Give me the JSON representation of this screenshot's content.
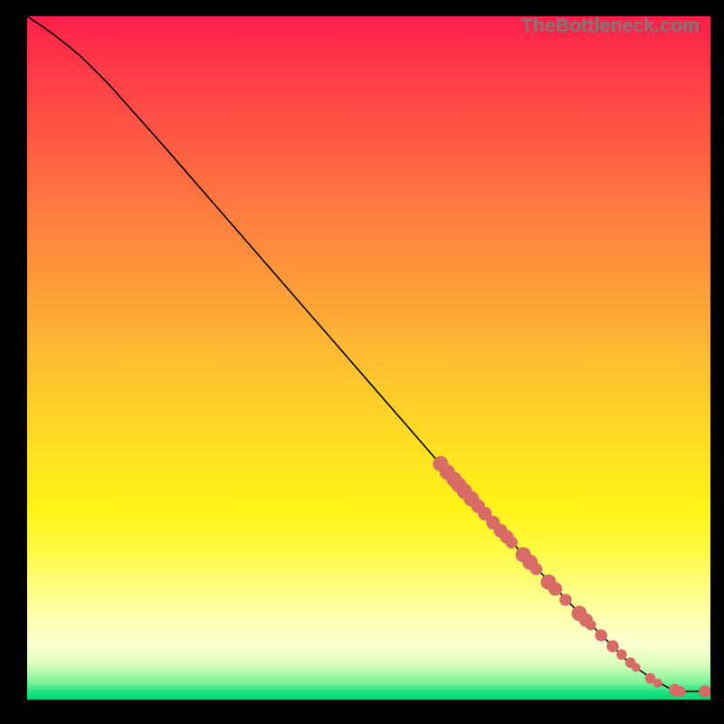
{
  "attribution": "TheBottleneck.com",
  "colors": {
    "dot": "#d96b66",
    "curve": "#000000",
    "gradient_top": "#ff1f4a",
    "gradient_bottom": "#00d977"
  },
  "chart_data": {
    "type": "line",
    "title": "",
    "xlabel": "",
    "ylabel": "",
    "xlim": [
      0,
      100
    ],
    "ylim": [
      0,
      100
    ],
    "curve": [
      {
        "x": 0,
        "y": 100
      },
      {
        "x": 4,
        "y": 97.5
      },
      {
        "x": 8,
        "y": 94
      },
      {
        "x": 12,
        "y": 90
      },
      {
        "x": 20,
        "y": 81
      },
      {
        "x": 30,
        "y": 69.5
      },
      {
        "x": 40,
        "y": 58
      },
      {
        "x": 50,
        "y": 46.5
      },
      {
        "x": 60,
        "y": 35
      },
      {
        "x": 70,
        "y": 24
      },
      {
        "x": 80,
        "y": 13.5
      },
      {
        "x": 88,
        "y": 5.5
      },
      {
        "x": 92,
        "y": 2.5
      },
      {
        "x": 95,
        "y": 1.2
      },
      {
        "x": 96,
        "y": 1.2
      },
      {
        "x": 100,
        "y": 1.2
      }
    ],
    "series": [
      {
        "name": "points",
        "marker": "circle",
        "points": [
          {
            "x": 60.5,
            "y": 34.5,
            "r": 1.2
          },
          {
            "x": 61.5,
            "y": 33.3,
            "r": 1.2
          },
          {
            "x": 62.5,
            "y": 32.2,
            "r": 1.2
          },
          {
            "x": 63.2,
            "y": 31.4,
            "r": 1.2
          },
          {
            "x": 64.0,
            "y": 30.5,
            "r": 1.2
          },
          {
            "x": 65.0,
            "y": 29.4,
            "r": 1.2
          },
          {
            "x": 66.0,
            "y": 28.3,
            "r": 1.1
          },
          {
            "x": 67.0,
            "y": 27.2,
            "r": 1.1
          },
          {
            "x": 68.2,
            "y": 25.9,
            "r": 1.1
          },
          {
            "x": 69.3,
            "y": 24.7,
            "r": 1.1
          },
          {
            "x": 70.2,
            "y": 23.8,
            "r": 1.1
          },
          {
            "x": 70.9,
            "y": 23.0,
            "r": 1.0
          },
          {
            "x": 72.6,
            "y": 21.2,
            "r": 1.2
          },
          {
            "x": 73.6,
            "y": 20.1,
            "r": 1.2
          },
          {
            "x": 74.5,
            "y": 19.1,
            "r": 1.0
          },
          {
            "x": 76.3,
            "y": 17.2,
            "r": 1.2
          },
          {
            "x": 77.3,
            "y": 16.2,
            "r": 1.1
          },
          {
            "x": 78.8,
            "y": 14.6,
            "r": 1.0
          },
          {
            "x": 80.8,
            "y": 12.6,
            "r": 1.2
          },
          {
            "x": 81.8,
            "y": 11.6,
            "r": 1.1
          },
          {
            "x": 82.5,
            "y": 10.9,
            "r": 0.9
          },
          {
            "x": 84.0,
            "y": 9.4,
            "r": 1.0
          },
          {
            "x": 85.7,
            "y": 7.8,
            "r": 1.0
          },
          {
            "x": 87.0,
            "y": 6.6,
            "r": 0.9
          },
          {
            "x": 88.3,
            "y": 5.4,
            "r": 0.9
          },
          {
            "x": 89.1,
            "y": 4.7,
            "r": 0.8
          },
          {
            "x": 91.2,
            "y": 3.1,
            "r": 0.9
          },
          {
            "x": 92.3,
            "y": 2.4,
            "r": 0.8
          },
          {
            "x": 94.8,
            "y": 1.4,
            "r": 1.0
          },
          {
            "x": 95.6,
            "y": 1.2,
            "r": 0.9
          },
          {
            "x": 99.2,
            "y": 1.2,
            "r": 1.0
          }
        ]
      }
    ]
  }
}
